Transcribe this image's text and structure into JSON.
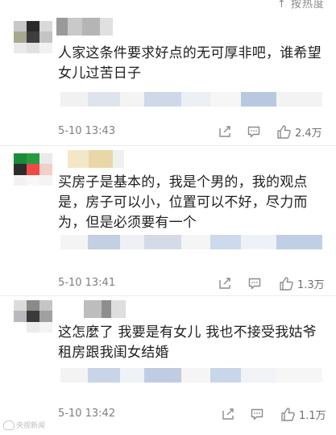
{
  "header": {
    "link_text": "↑ 按热度"
  },
  "comments": [
    {
      "text": "人家这条件要求好点的无可厚非吧，谁希望女儿过苦日子",
      "time": "5-10 13:43",
      "likes": "2.4万",
      "avatar_colors": [
        "#c8c8c8",
        "#2a2a2a",
        "#d9d9d9",
        "#a8a890",
        "#3e3e3e",
        "#c4c4c4",
        "#eaeaea",
        "#e0e0e0",
        "#f2f2f2"
      ],
      "name_colors": [
        "#9a9a9a",
        "#c9c9c9",
        "#b5b5b5",
        "#e0e0e0"
      ],
      "quote_colors": [
        "#f1f1f1",
        "#dfe4ec",
        "#f4f4f4",
        "#cfd8e8",
        "#eceff4",
        "#f6f6f6",
        "#b8c8e0",
        "#f3f3f3"
      ]
    },
    {
      "text": "买房子是基本的，我是个男的，我的观点是，房子可以小，位置可以不好，尽力而为，但是必须要有一个",
      "time": "5-10 13:41",
      "likes": "1.3万",
      "avatar_colors": [
        "#1f8a3c",
        "#2a9a44",
        "#eaeaea",
        "#2c2c2c",
        "#e84a4a",
        "#f0d0c8",
        "#f2f2f2",
        "#f7f7f7",
        "#f4f4f4"
      ],
      "name_colors": [
        "#f4e7c8",
        "#e9d7a8",
        "#efefef"
      ],
      "quote_colors": [
        "#f4f4f4",
        "#c3cfe3",
        "#eef0f4",
        "#d4dbe6",
        "#f5f5f5",
        "#cdd9ec",
        "#eef1f6",
        "#c0cfe6"
      ]
    },
    {
      "text": "这怎麼了 我要是有女儿 我也不接受我姑爷租房跟我闺女结婚",
      "time": "5-10 13:42",
      "likes": "1.1万",
      "avatar_colors": [
        "#dcdcdc",
        "#8a8a8a",
        "#c5c5c5",
        "#b8b8c0",
        "#3a3a3a",
        "#a0a0a0",
        "#ffffff",
        "#ececec",
        "#f4f4f4"
      ],
      "name_colors": [
        "#bdbdbd",
        "#8e8e8e",
        "#dedede"
      ],
      "quote_colors": [
        "#f3f3f3",
        "#c9d4e6",
        "#eff2f6",
        "#bfcde4",
        "#f5f5f5",
        "#c8d6ea",
        "#f1f3f7",
        "#f6f6f6"
      ]
    }
  ],
  "watermark": {
    "text": "央视新闻"
  }
}
